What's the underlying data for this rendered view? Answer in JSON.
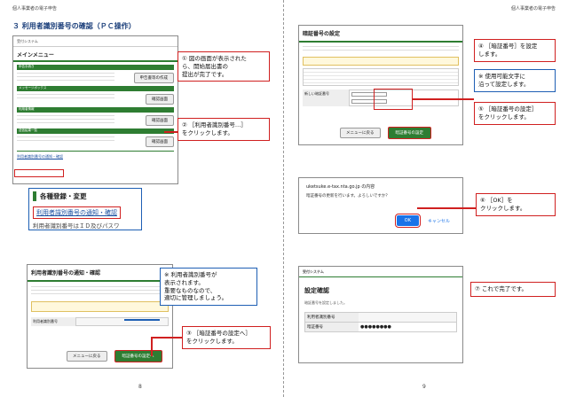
{
  "header": "個人事業者の電子申告",
  "left": {
    "page_no": "8",
    "section_title": "３ 利用者識別番号の確認（ＰＣ操作）",
    "shot1": {
      "system": "受付システム",
      "menu_title": "メインメニュー",
      "bar_labels": [
        "申告手続き",
        "メッセージボックス",
        "利用者情報",
        "送信結果一覧"
      ],
      "link1": "申告書等の作成",
      "link2": "確認画面",
      "link3": "利用者識別番号の通知・確認"
    },
    "callout1": "① 図の画面が表示された\nら、開始届出書の\n提出が完了です。",
    "callout2": "② ［利用者識別番号…］\nをクリックします。",
    "zoom": {
      "heading": "各種登録・変更",
      "link": "利用者識別番号の通知・確認",
      "sub": "利用者識別番号はＩＤ及びパスワ"
    },
    "shot2": {
      "title": "利用者識別番号の通知・確認",
      "field_label": "利用者識別番号",
      "back": "メニューに戻る",
      "set": "暗証番号の設定へ"
    },
    "callout_blue": "※ 利用者識別番号が\n表示されます。\n重要なものなので、\n適切に管理しましょう。",
    "callout3": "③ ［暗証番号の設定へ］\nをクリックします。"
  },
  "right": {
    "page_no": "9",
    "shot1": {
      "title": "暗証番号の設定",
      "new_pin": "新しい暗証番号",
      "back": "メニューに戻る",
      "set": "暗証番号の設定"
    },
    "callout4": "④ ［暗証番号］を設定\nします。",
    "callout_blue2": "※ 使用可能文字に\n沿って設定します。",
    "callout5": "⑤ ［暗証番号の設定］\nをクリックします。",
    "dialog": {
      "host": "uketsuke.e-tax.nta.go.jp の内容",
      "msg": "暗証番号の更新を行います。よろしいですか？",
      "ok": "OK",
      "cancel": "キャンセル"
    },
    "callout6": "⑥ ［OK］を\nクリックします。",
    "shot3": {
      "system": "受付システム",
      "title": "設定確認",
      "msg": "暗証番号を設定しました。",
      "row1": "利用者識別番号",
      "row2": "暗証番号",
      "masked": "●●●●●●●●"
    },
    "callout7": "⑦ これで完了です。"
  }
}
